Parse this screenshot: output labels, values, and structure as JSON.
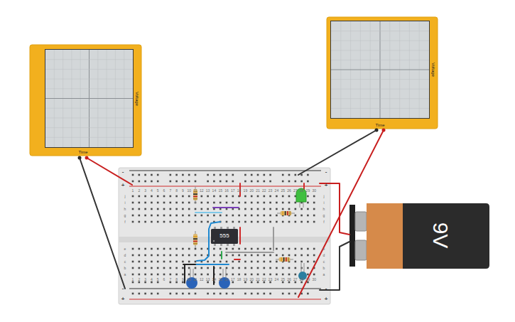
{
  "oscilloscopes": [
    {
      "x_label": "Time",
      "y_label": "Voltage"
    },
    {
      "x_label": "Time",
      "y_label": "Voltage"
    }
  ],
  "breadboard": {
    "columns": [
      "1",
      "2",
      "3",
      "4",
      "5",
      "6",
      "7",
      "8",
      "9",
      "10",
      "11",
      "12",
      "13",
      "14",
      "15",
      "16",
      "17",
      "18",
      "19",
      "20",
      "21",
      "22",
      "23",
      "24",
      "25",
      "26",
      "27",
      "28",
      "29",
      "30"
    ],
    "rows_top": [
      "j",
      "i",
      "h",
      "g",
      "f"
    ],
    "rows_bottom": [
      "e",
      "d",
      "c",
      "b",
      "a"
    ],
    "rail_labels": [
      "-",
      "+"
    ]
  },
  "chip": {
    "label": "555"
  },
  "battery": {
    "label": "9V"
  }
}
